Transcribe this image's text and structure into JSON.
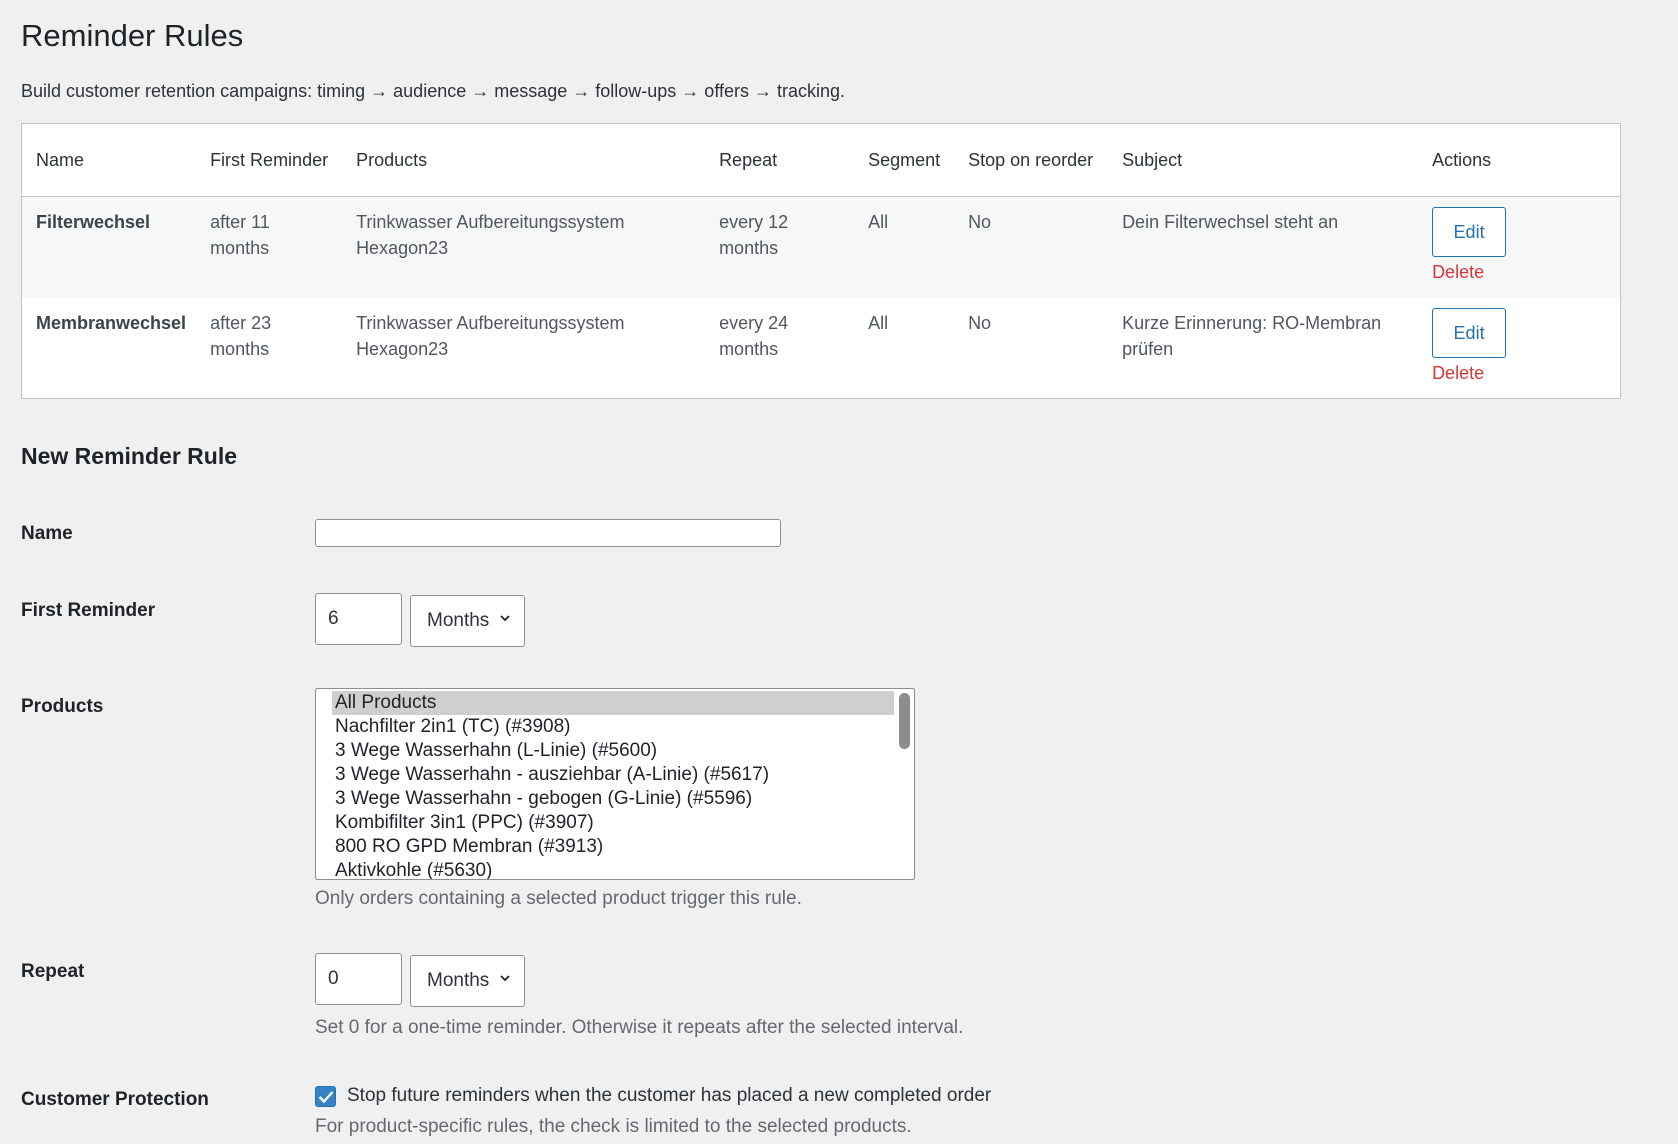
{
  "page": {
    "title": "Reminder Rules",
    "intro": "Build customer retention campaigns: timing → audience → message → follow-ups → offers → tracking."
  },
  "table": {
    "headers": [
      "Name",
      "First Reminder",
      "Products",
      "Repeat",
      "Segment",
      "Stop on reorder",
      "Subject",
      "Actions"
    ],
    "rows": [
      {
        "name": "Filterwechsel",
        "first_reminder": "after 11 months",
        "products": "Trinkwasser Aufbereitungssystem Hexagon23",
        "repeat": "every 12 months",
        "segment": "All",
        "stop_on_reorder": "No",
        "subject": "Dein Filterwechsel steht an",
        "edit_label": "Edit",
        "delete_label": "Delete"
      },
      {
        "name": "Membranwechsel",
        "first_reminder": "after 23 months",
        "products": "Trinkwasser Aufbereitungssystem Hexagon23",
        "repeat": "every 24 months",
        "segment": "All",
        "stop_on_reorder": "No",
        "subject": "Kurze Erinnerung: RO-Membran prüfen",
        "edit_label": "Edit",
        "delete_label": "Delete"
      }
    ]
  },
  "form": {
    "section_title": "New Reminder Rule",
    "name": {
      "label": "Name",
      "value": ""
    },
    "first_reminder": {
      "label": "First Reminder",
      "value": "6",
      "unit": "Months"
    },
    "products": {
      "label": "Products",
      "options": [
        "All Products",
        "Nachfilter 2in1 (TC) (#3908)",
        "3 Wege Wasserhahn (L-Linie) (#5600)",
        "3 Wege Wasserhahn - ausziehbar (A-Linie) (#5617)",
        "3 Wege Wasserhahn - gebogen (G-Linie) (#5596)",
        "Kombifilter 3in1 (PPC) (#3907)",
        "800 RO GPD Membran (#3913)",
        "Aktivkohle (#5630)"
      ],
      "selected": "All Products",
      "hint": "Only orders containing a selected product trigger this rule."
    },
    "repeat": {
      "label": "Repeat",
      "value": "0",
      "unit": "Months",
      "hint": "Set 0 for a one-time reminder. Otherwise it repeats after the selected interval."
    },
    "customer_protection": {
      "label": "Customer Protection",
      "checked": true,
      "checkbox_label": "Stop future reminders when the customer has placed a new completed order",
      "hint": "For product-specific rules, the check is limited to the selected products."
    }
  },
  "colors": {
    "background": "#f0f0f1",
    "accent": "#2271b1",
    "danger": "#d63638",
    "checkbox": "#3582c4"
  }
}
